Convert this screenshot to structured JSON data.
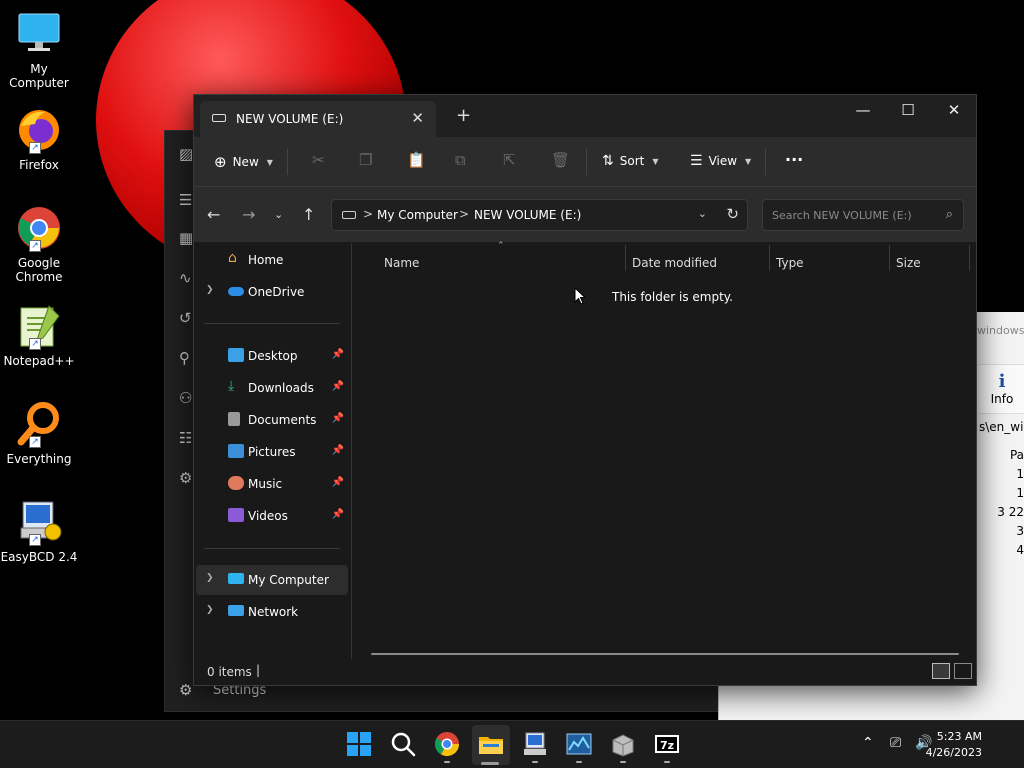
{
  "desktop": {
    "icons": [
      {
        "label": "My Computer"
      },
      {
        "label": "Firefox"
      },
      {
        "label": "Google Chrome"
      },
      {
        "label": "Notepad++"
      },
      {
        "label": "Everything"
      },
      {
        "label": "EasyBCD 2.4"
      }
    ]
  },
  "background_windows": {
    "settings": {
      "label": "Settings"
    },
    "sevenzip": {
      "title_fragment": "windows_",
      "info_label": "Info",
      "path_fragment": "s\\en_wind",
      "col_fragment": "Pa",
      "values": [
        "1",
        "1",
        "3 22",
        "3",
        "4"
      ]
    }
  },
  "explorer": {
    "tab_title": "NEW VOLUME (E:)",
    "new_tab": "+",
    "window_controls": {
      "minimize": "—",
      "maximize": "☐",
      "close": "✕"
    },
    "commandbar": {
      "new_label": "New",
      "sort_label": "Sort",
      "view_label": "View",
      "more_label": "···"
    },
    "address": {
      "crumbs": [
        "My Computer",
        "NEW VOLUME (E:)"
      ],
      "separator": ">",
      "search_placeholder": "Search NEW VOLUME (E:)"
    },
    "nav": {
      "home": "Home",
      "onedrive": "OneDrive",
      "quick": [
        {
          "label": "Desktop",
          "color": "#3aa0e8"
        },
        {
          "label": "Downloads",
          "color": "#39b27a"
        },
        {
          "label": "Documents",
          "color": "#9a9a9a"
        },
        {
          "label": "Pictures",
          "color": "#3a8fd8"
        },
        {
          "label": "Music",
          "color": "#e07a5a"
        },
        {
          "label": "Videos",
          "color": "#8a5ad8"
        }
      ],
      "mycomputer": "My Computer",
      "network": "Network"
    },
    "columns": [
      "Name",
      "Date modified",
      "Type",
      "Size"
    ],
    "empty_message": "This folder is empty.",
    "status": "0 items"
  },
  "taskbar": {
    "clock_time": "5:23 AM",
    "clock_date": "4/26/2023"
  },
  "colors": {
    "accent": "#0078d4",
    "explorer_bg": "#191919",
    "toolbar_bg": "#2c2c2c"
  }
}
